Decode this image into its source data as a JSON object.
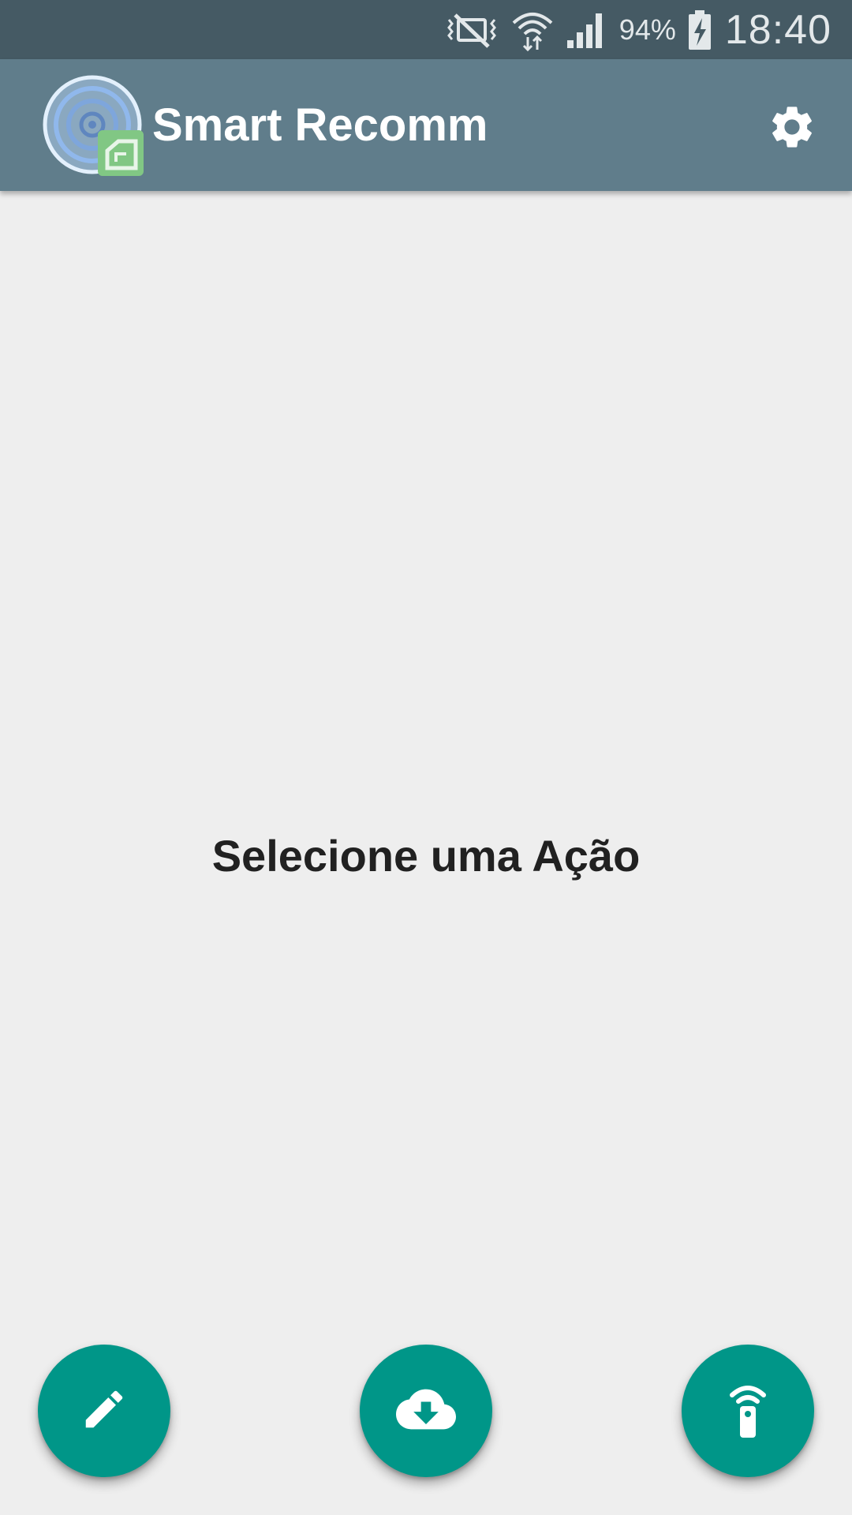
{
  "status_bar": {
    "battery_percent": "94%",
    "clock": "18:40",
    "icons": [
      "vibrate-off-icon",
      "wifi-icon",
      "cell-signal-icon",
      "battery-charging-icon"
    ]
  },
  "app_bar": {
    "title": "Smart Recomm",
    "logo_icon": "app-logo-icon",
    "settings_icon": "gear-icon"
  },
  "main": {
    "message": "Selecione uma Ação"
  },
  "fabs": [
    {
      "name": "edit",
      "icon": "pencil-icon"
    },
    {
      "name": "download",
      "icon": "cloud-download-icon"
    },
    {
      "name": "remote",
      "icon": "remote-control-icon"
    }
  ],
  "colors": {
    "status_bar": "#455a64",
    "app_bar": "#607d8b",
    "background": "#eeeeee",
    "fab": "#009688",
    "text": "#212121"
  }
}
